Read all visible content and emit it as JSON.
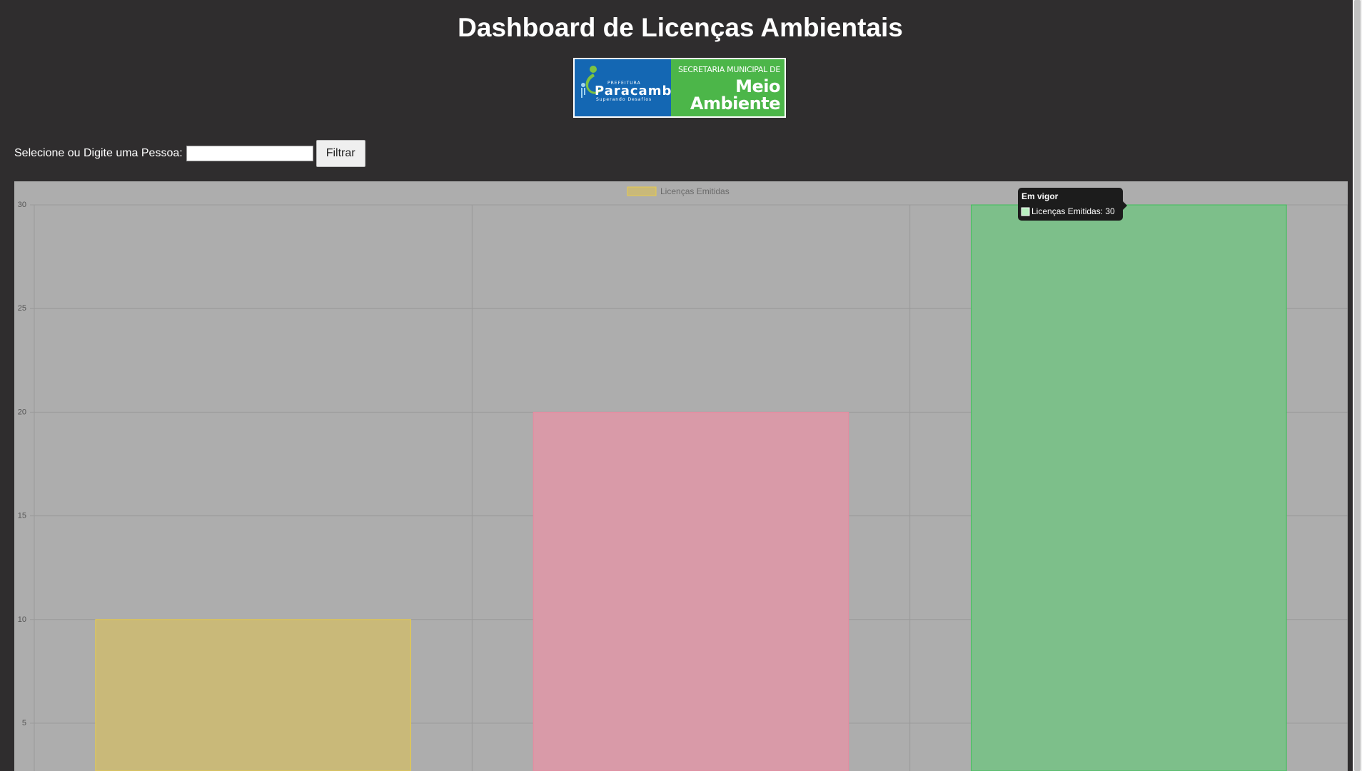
{
  "header": {
    "title": "Dashboard de Licenças Ambientais"
  },
  "logo": {
    "left_top": "PREFEITURA",
    "left_name": "Paracambi",
    "left_tagline": "Superando Desafios",
    "right_top": "SECRETARIA MUNICIPAL DE",
    "right_line1": "Meio",
    "right_line2": "Ambiente",
    "colors": {
      "left_bg": "#1467b3",
      "right_bg": "#4cb649"
    }
  },
  "filter": {
    "label": "Selecione ou Digite uma Pessoa:",
    "input_value": "",
    "button_label": "Filtrar"
  },
  "chart_data": {
    "type": "bar",
    "categories": [
      "",
      "",
      "Em vigor"
    ],
    "series": [
      {
        "name": "Licenças Emitidas",
        "values": [
          10,
          20,
          30
        ],
        "colors": [
          "#c9b979",
          "#d99aa8",
          "#7dbf8a"
        ],
        "border_colors": [
          "#e8cc4a",
          "#e88aa0",
          "#3fbf5a"
        ]
      }
    ],
    "y_ticks": [
      5,
      10,
      15,
      20,
      25,
      30
    ],
    "ylim": [
      0,
      30
    ],
    "grid": true,
    "legend": "top-center",
    "legend_swatch_color": "#c9b979",
    "legend_swatch_border": "#e8cc4a",
    "tooltip": {
      "title": "Em vigor",
      "label": "Licenças Emitidas: 30",
      "swatch_color": "#b8f0c0"
    }
  }
}
